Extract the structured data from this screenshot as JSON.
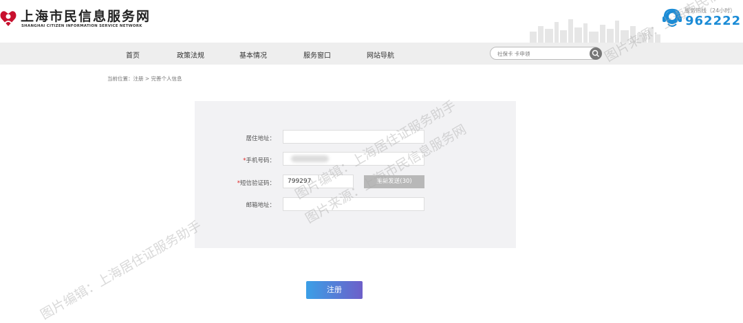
{
  "header": {
    "title": "上海市民信息服务网",
    "subtitle": "SHANGHAI CITIZEN INFORMATION SERVICE NETWORK",
    "hotline_label": "服务热线（24小时）",
    "hotline_number": "962222",
    "logo_icon": "heart-person-icon",
    "hotline_icon": "headset-icon"
  },
  "nav": {
    "items": [
      "首页",
      "政策法规",
      "基本情况",
      "服务窗口",
      "网站导航"
    ],
    "search_placeholder": "社保卡 卡申领",
    "search_icon": "search-icon"
  },
  "breadcrumb": "当前位置：注册 > 完善个人信息",
  "form": {
    "address_label": "居住地址：",
    "address_value": "",
    "phone_label": "手机号码：",
    "sms_label": "短信验证码：",
    "sms_value": "799297",
    "resend_label": "重新发送(30)",
    "email_label": "邮箱地址：",
    "email_value": "",
    "required_mark": "*"
  },
  "submit_label": "注册",
  "watermarks": {
    "line1": "图片编辑：上海居住证服务助手",
    "line2": "图片来源：上海市民信息服务网"
  },
  "colors": {
    "accent": "#1a8bd6",
    "brand_red": "#c8102e",
    "nav_bg": "#eeeeee",
    "panel_bg": "#f2f2f4"
  }
}
